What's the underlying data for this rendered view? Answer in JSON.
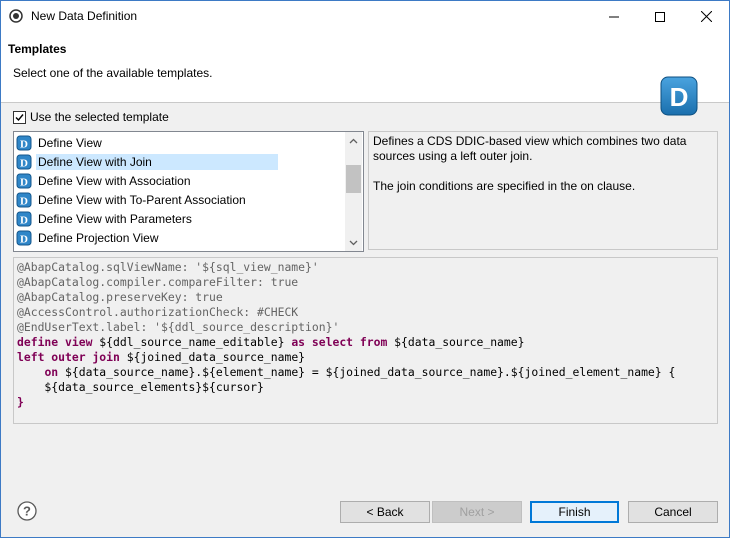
{
  "window": {
    "title": "New Data Definition"
  },
  "header": {
    "title": "Templates",
    "subtitle": "Select one of the available templates.",
    "logo_letter": "D"
  },
  "use_template": {
    "label": "Use the selected template",
    "checked": true
  },
  "templates": [
    {
      "label": "Define View",
      "selected": false
    },
    {
      "label": "Define View with Join",
      "selected": true
    },
    {
      "label": "Define View with Association",
      "selected": false
    },
    {
      "label": "Define View with To-Parent Association",
      "selected": false
    },
    {
      "label": "Define View with Parameters",
      "selected": false
    },
    {
      "label": "Define Projection View",
      "selected": false
    }
  ],
  "description": {
    "line1": "Defines a CDS DDIC-based view which combines two data",
    "line2": "sources using a left outer join.",
    "line3": "The join conditions are specified in the on clause."
  },
  "code": {
    "line1": "@AbapCatalog.sqlViewName: '${sql_view_name}'",
    "line2": "@AbapCatalog.compiler.compareFilter: true",
    "line3": "@AbapCatalog.preserveKey: true",
    "line4": "@AccessControl.authorizationCheck: #CHECK",
    "line5": "@EndUserText.label: '${ddl_source_description}'",
    "line6_kw1": "define view",
    "line6_a": " ${ddl_source_name_editable} ",
    "line6_kw2": "as select from",
    "line6_b": " ${data_source_name}",
    "line7_kw": "left outer join",
    "line7_a": " ${joined_data_source_name}",
    "line8_indent": "    ",
    "line8_kw": "on",
    "line8_a": " ${data_source_name}.${element_name} = ${joined_data_source_name}.${joined_element_name} {",
    "line9": "    ${data_source_elements}${cursor}",
    "line10": "}"
  },
  "buttons": {
    "back": "< Back",
    "next": "Next >",
    "finish": "Finish",
    "cancel": "Cancel"
  },
  "icons": {
    "help": "help-icon",
    "template": "ddl-template-icon"
  }
}
